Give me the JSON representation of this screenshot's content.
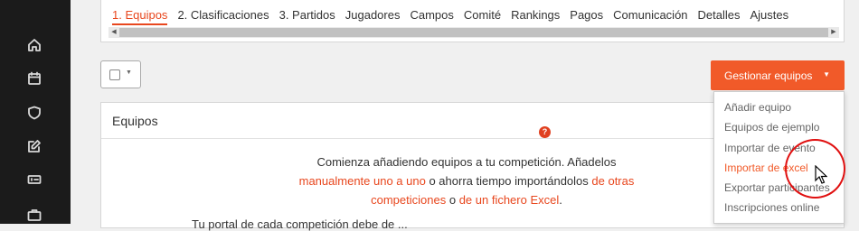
{
  "tabs": [
    {
      "label": "1. Equipos"
    },
    {
      "label": "2. Clasificaciones"
    },
    {
      "label": "3. Partidos"
    },
    {
      "label": "Jugadores"
    },
    {
      "label": "Campos"
    },
    {
      "label": "Comité"
    },
    {
      "label": "Rankings"
    },
    {
      "label": "Pagos"
    },
    {
      "label": "Comunicación"
    },
    {
      "label": "Detalles"
    },
    {
      "label": "Ajustes"
    }
  ],
  "active_tab": "1. Equipos",
  "toolbar": {
    "manage_label": "Gestionar equipos"
  },
  "dropdown": {
    "items": [
      {
        "label": "Añadir equipo"
      },
      {
        "label": "Equipos de ejemplo"
      },
      {
        "label": "Importar de evento"
      },
      {
        "label": "Importar de excel"
      },
      {
        "label": "Exportar participantes"
      },
      {
        "label": "Inscripciones online"
      }
    ],
    "hovered": "Importar de excel"
  },
  "panel": {
    "title": "Equipos",
    "text_1": "Comienza añadiendo equipos a tu competición. Añadelos",
    "link_1": "manualmente uno a uno",
    "text_2": " o ahorra tiempo importándolos ",
    "link_2": "de otras competiciones",
    "text_3": " o ",
    "link_3": "de un fichero Excel",
    "text_4": ".",
    "help_symbol": "?",
    "cut_text": "Tu portal de cada competición debe de ..."
  },
  "sidebar": {
    "icons": [
      "home-icon",
      "calendar-icon",
      "shield-icon",
      "edit-icon",
      "ticket-icon",
      "briefcase-icon"
    ]
  },
  "colors": {
    "accent": "#f15a29",
    "sidebar_bg": "#1b1b1b"
  }
}
